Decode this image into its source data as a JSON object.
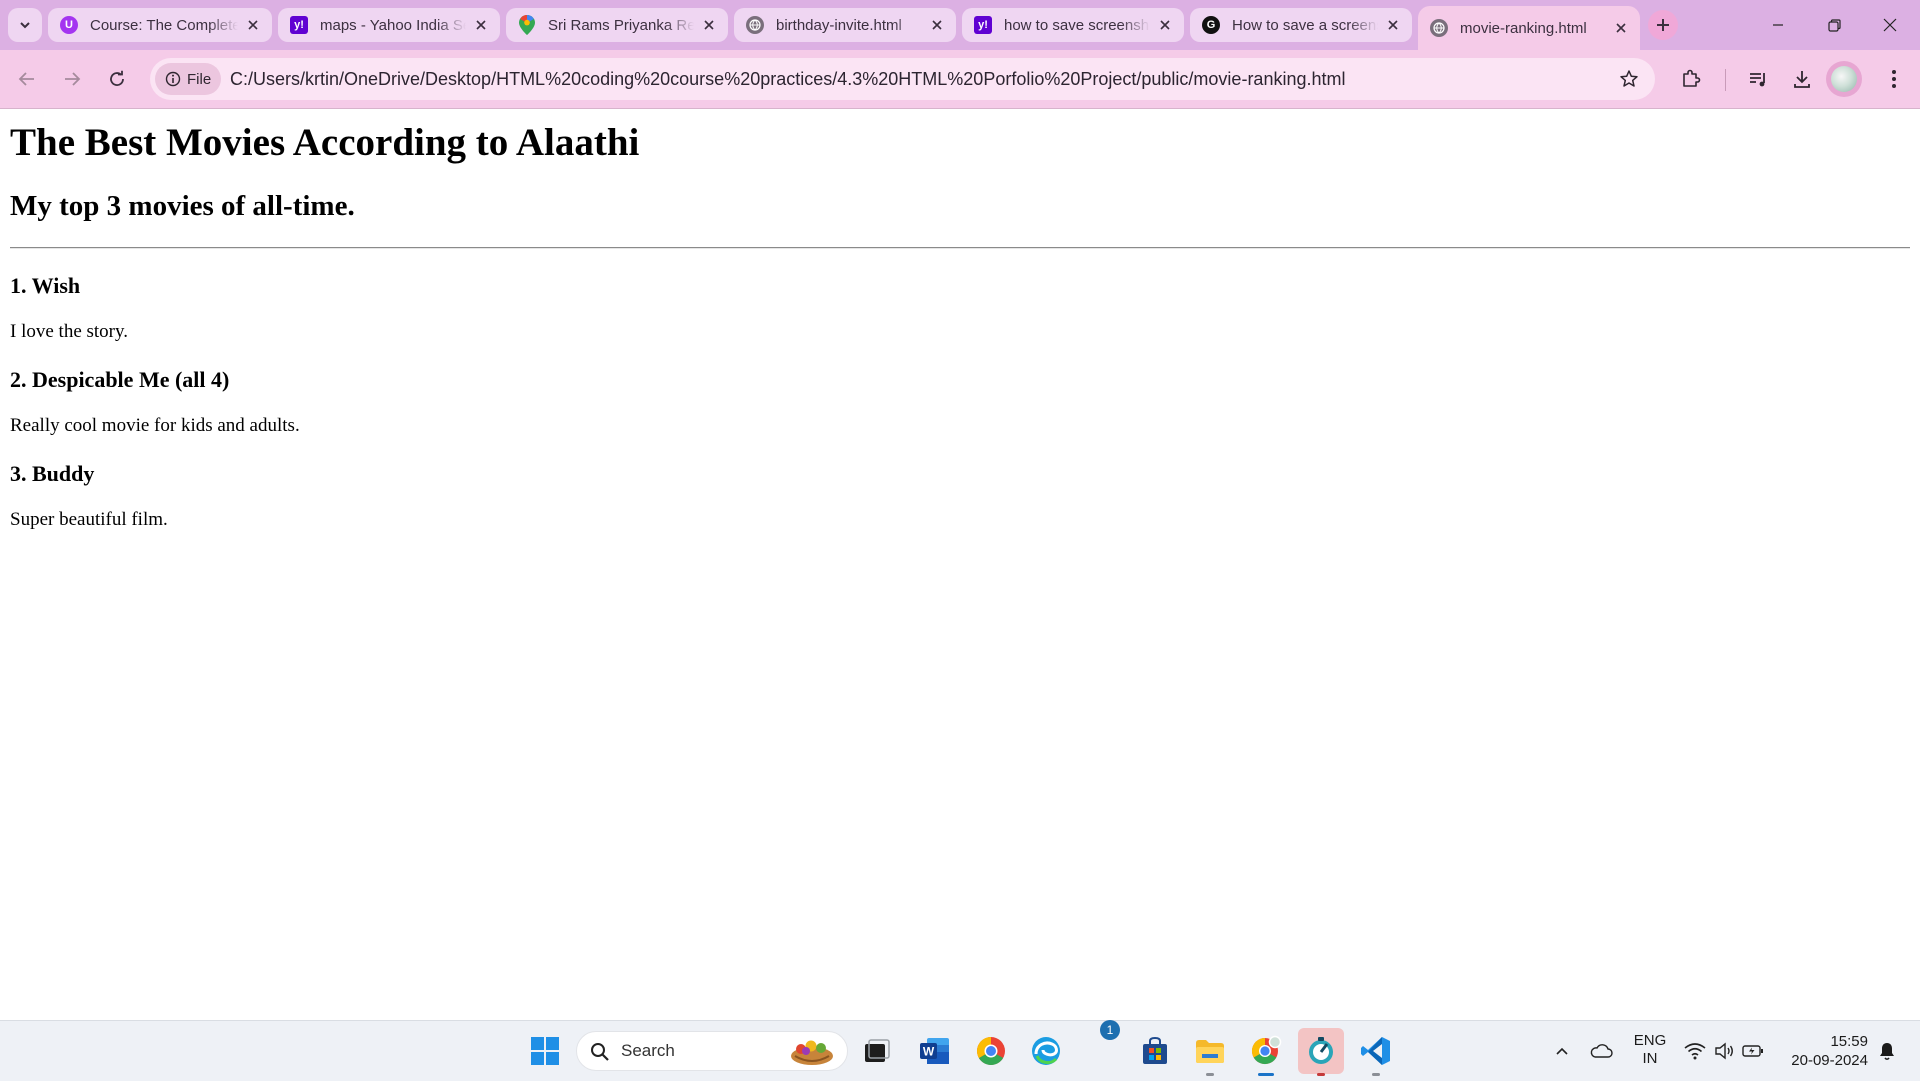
{
  "browser": {
    "tabs": [
      {
        "title": "Course: The Complete Web Development Bootcamp",
        "favicon": "udemy-icon",
        "color": "#a435f0"
      },
      {
        "title": "maps - Yahoo India Search Results",
        "favicon": "yahoo-icon",
        "color": "#6001d2"
      },
      {
        "title": "Sri Rams Priyanka Residency",
        "favicon": "google-maps-icon",
        "color": "#34a853"
      },
      {
        "title": "birthday-invite.html",
        "favicon": "globe-icon",
        "color": "#7a6f7c"
      },
      {
        "title": "how to save screenshots",
        "favicon": "yahoo-icon",
        "color": "#6001d2"
      },
      {
        "title": "How to save a screenshot",
        "favicon": "google-icon",
        "color": "#111111"
      },
      {
        "title": "movie-ranking.html",
        "favicon": "globe-icon",
        "color": "#7a6f7c",
        "active": true
      }
    ],
    "chip_label": "File",
    "url": "C:/Users/krtin/OneDrive/Desktop/HTML%20coding%20course%20practices/4.3%20HTML%20Porfolio%20Project/public/movie-ranking.html",
    "accent": "#f5cbe8"
  },
  "page": {
    "title": "The Best Movies According to Alaathi",
    "subtitle": "My top 3 movies of all-time.",
    "movies": [
      {
        "heading": "1. Wish",
        "comment": "I love the story."
      },
      {
        "heading": "2. Despicable Me (all 4)",
        "comment": "Really cool movie for kids and adults."
      },
      {
        "heading": "3. Buddy",
        "comment": "Super beautiful film."
      }
    ]
  },
  "taskbar": {
    "search_label": "Search",
    "store_badge": "1",
    "language": {
      "line1": "ENG",
      "line2": "IN"
    },
    "clock": {
      "time": "15:59",
      "date": "20-09-2024"
    }
  }
}
